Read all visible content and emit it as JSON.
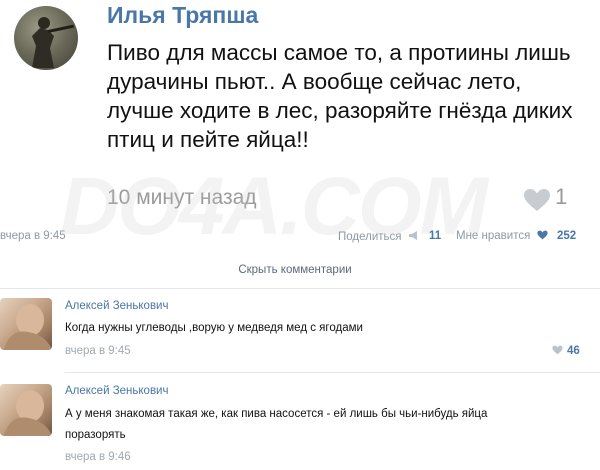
{
  "post": {
    "author": "Илья Тряпша",
    "text": "Пиво для массы самое то, а протиины лишь дурачины пьют.. А вообще сейчас лето, лучше ходите в лес, разоряйте гнёзда диких птиц и пейте яйца!!",
    "time": "10 минут назад",
    "likes": "1"
  },
  "watermark": "DO4A.COM",
  "original": {
    "date": "вчера в 9:45",
    "share_label": "Поделиться",
    "share_count": "11",
    "like_label": "Мне нравится",
    "like_count": "252"
  },
  "hide_comments": "Скрыть комментарии",
  "comments": [
    {
      "author": "Алексей Зенькович",
      "text": "Когда нужны углеводы ,ворую у медведя мед с ягодами",
      "date": "вчера в 9:45",
      "likes": "46"
    },
    {
      "author": "Алексей Зенькович",
      "text": "А у меня знакомая такая же, как пива насосется - ей лишь бы чьи-нибудь яйца поразорять",
      "date": "вчера в 9:46"
    }
  ]
}
